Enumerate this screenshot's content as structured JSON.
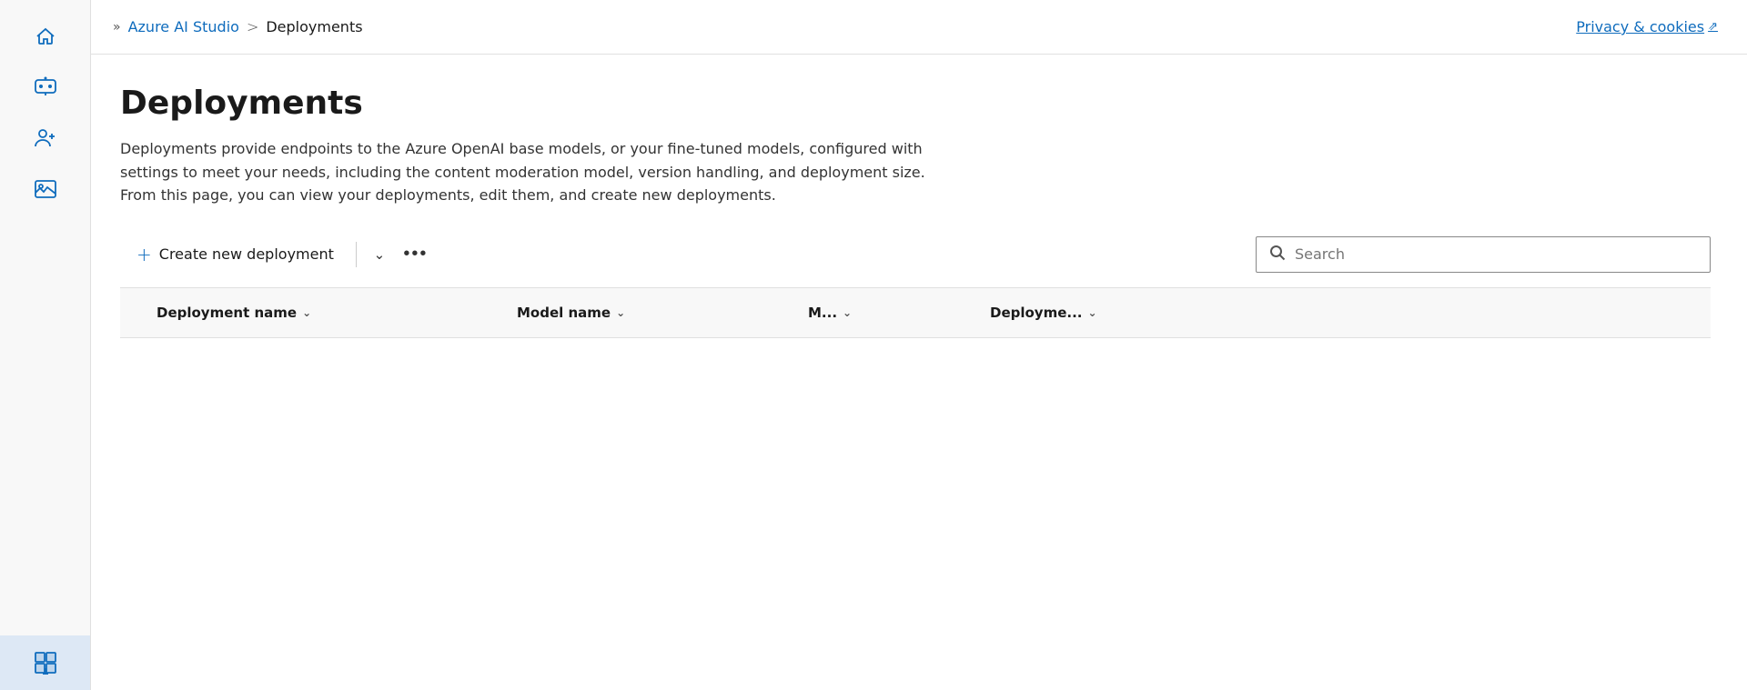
{
  "sidebar": {
    "items": [
      {
        "id": "home",
        "icon": "home",
        "label": "Home",
        "active": false
      },
      {
        "id": "chat",
        "icon": "chat-bot",
        "label": "Chat",
        "active": false
      },
      {
        "id": "users",
        "icon": "users",
        "label": "Users",
        "active": false
      },
      {
        "id": "gallery",
        "icon": "gallery",
        "label": "Gallery",
        "active": false
      },
      {
        "id": "deployments-nav",
        "icon": "deployments",
        "label": "Deployments",
        "active": true
      }
    ]
  },
  "breadcrumb": {
    "expand_label": ">>",
    "parent_link": "Azure AI Studio",
    "separator": ">",
    "current": "Deployments"
  },
  "privacy": {
    "label": "Privacy & cookies",
    "external_icon": "↗"
  },
  "page": {
    "title": "Deployments",
    "description": "Deployments provide endpoints to the Azure OpenAI base models, or your fine-tuned models, configured with settings to meet your needs, including the content moderation model, version handling, and deployment size. From this page, you can view your deployments, edit them, and create new deployments."
  },
  "toolbar": {
    "create_label": "Create new deployment",
    "plus_icon": "+",
    "dropdown_icon": "∨",
    "more_icon": "···",
    "search_placeholder": "Search"
  },
  "table": {
    "columns": [
      {
        "id": "deployment-name",
        "label": "Deployment name",
        "sortable": true
      },
      {
        "id": "model-name",
        "label": "Model name",
        "sortable": true
      },
      {
        "id": "m",
        "label": "M...",
        "sortable": true
      },
      {
        "id": "deployme",
        "label": "Deployme...",
        "sortable": true
      }
    ]
  }
}
